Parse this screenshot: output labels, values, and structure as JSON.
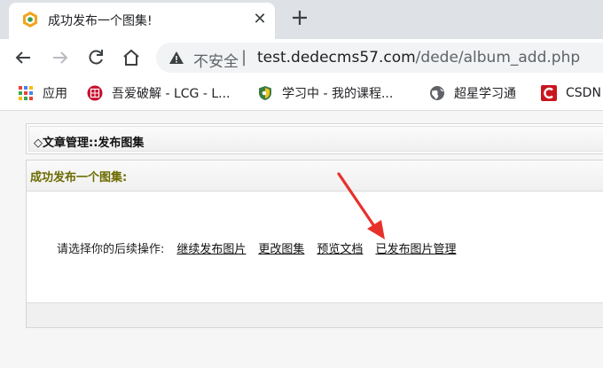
{
  "browser": {
    "tab": {
      "title": "成功发布一个图集!",
      "favicon": "dedecms-favicon-icon"
    },
    "address": {
      "security_label": "不安全",
      "separator": "|",
      "host": "test.dedecms57.com",
      "path": "/dede/album_add.php"
    },
    "bookmarks": [
      {
        "label": "应用",
        "icon": "apps-grid-icon"
      },
      {
        "label": "吾爱破解 - LCG - L...",
        "icon": "52pojie-icon"
      },
      {
        "label": "学习中 - 我的课程...",
        "icon": "shield-course-icon"
      },
      {
        "label": "超星学习通",
        "icon": "globe-icon"
      },
      {
        "label": "CSDN",
        "icon": "csdn-icon"
      }
    ]
  },
  "page": {
    "header_title": "◇文章管理::发布图集",
    "panel_title": "成功发布一个图集:",
    "prompt": "请选择你的后续操作:",
    "links": [
      "继续发布图片",
      "更改图集",
      "预览文档",
      "已发布图片管理"
    ]
  },
  "colors": {
    "panel_title": "#6b6b00",
    "annotation_arrow": "#e8302a",
    "csdn_red": "#c9151e"
  }
}
